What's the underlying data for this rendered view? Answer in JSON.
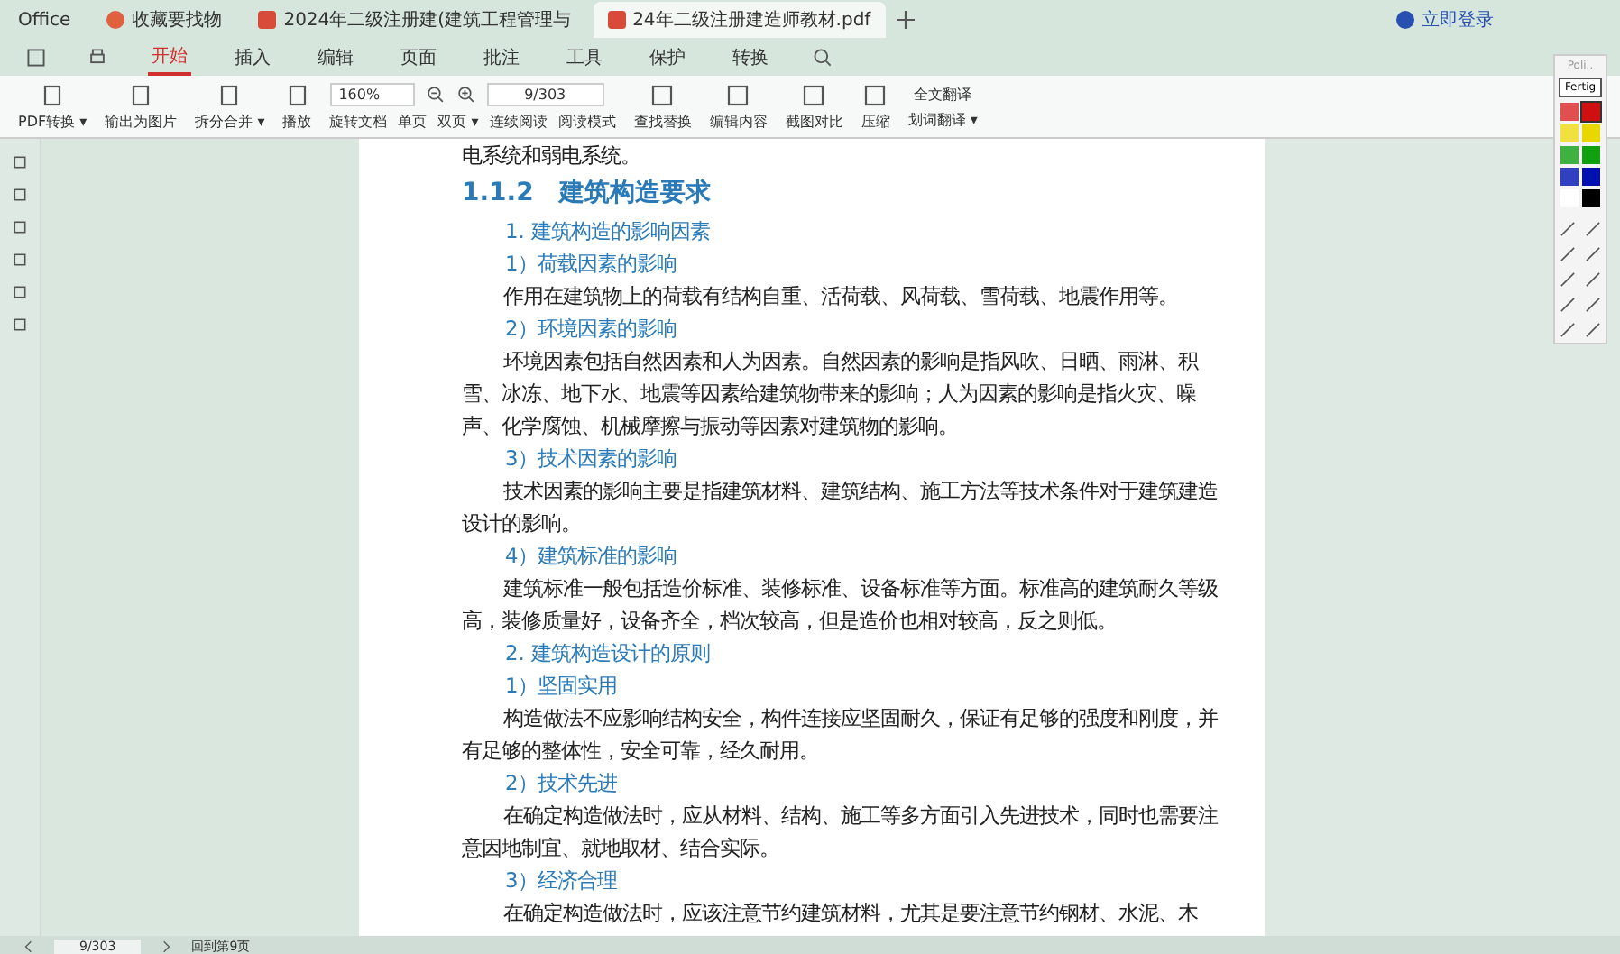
{
  "tabs": [
    {
      "label": "Office",
      "kind": "home",
      "selected": false
    },
    {
      "label": "收藏要找物",
      "kind": "doc",
      "selected": false
    },
    {
      "label": "2024年二级注册建(建筑工程管理与",
      "kind": "pdf",
      "selected": false
    },
    {
      "label": "24年二级注册建造师教材.pdf",
      "kind": "pdf",
      "selected": true
    }
  ],
  "account": {
    "label": "立即登录"
  },
  "menu": [
    {
      "label": "开始",
      "selected": true
    },
    {
      "label": "插入",
      "selected": false
    },
    {
      "label": "编辑",
      "selected": false
    },
    {
      "label": "页面",
      "selected": false
    },
    {
      "label": "批注",
      "selected": false
    },
    {
      "label": "工具",
      "selected": false
    },
    {
      "label": "保护",
      "selected": false
    },
    {
      "label": "转换",
      "selected": false
    }
  ],
  "ribbon": {
    "big": [
      {
        "label": "PDF转换 ▾"
      },
      {
        "label": "输出为图片"
      },
      {
        "label": "拆分合并 ▾"
      },
      {
        "label": "播放"
      }
    ],
    "zoom": "160%",
    "small": [
      {
        "label": "旋转文档"
      },
      {
        "label": "单页"
      },
      {
        "label": "双页 ▾"
      },
      {
        "label": "连续阅读"
      },
      {
        "label": "阅读模式"
      }
    ],
    "page": "9/303",
    "right": [
      {
        "label": "查找替换"
      },
      {
        "label": "编辑内容"
      },
      {
        "label": "截图对比"
      },
      {
        "label": "压缩"
      }
    ],
    "translate": [
      "全文翻译",
      "划词翻译 ▾"
    ]
  },
  "document": [
    {
      "kind": "paragraph",
      "text": "电系统和弱电系统。"
    },
    {
      "kind": "heading",
      "text": "1.1.2　建筑构造要求"
    },
    {
      "kind": "subheading",
      "text": "1. 建筑构造的影响因素"
    },
    {
      "kind": "subheading",
      "text": "1）荷载因素的影响"
    },
    {
      "kind": "paragraph",
      "text": "作用在建筑物上的荷载有结构自重、活荷载、风荷载、雪荷载、地震作用等。"
    },
    {
      "kind": "subheading",
      "text": "2）环境因素的影响"
    },
    {
      "kind": "paragraph",
      "text": "环境因素包括自然因素和人为因素。自然因素的影响是指风吹、日晒、雨淋、积雪、冰冻、地下水、地震等因素给建筑物带来的影响；人为因素的影响是指火灾、噪声、化学腐蚀、机械摩擦与振动等因素对建筑物的影响。"
    },
    {
      "kind": "subheading",
      "text": "3）技术因素的影响"
    },
    {
      "kind": "paragraph",
      "text": "技术因素的影响主要是指建筑材料、建筑结构、施工方法等技术条件对于建筑建造设计的影响。"
    },
    {
      "kind": "subheading",
      "text": "4）建筑标准的影响"
    },
    {
      "kind": "paragraph",
      "text": "建筑标准一般包括造价标准、装修标准、设备标准等方面。标准高的建筑耐久等级高，装修质量好，设备齐全，档次较高，但是造价也相对较高，反之则低。"
    },
    {
      "kind": "subheading",
      "text": "2. 建筑构造设计的原则"
    },
    {
      "kind": "subheading",
      "text": "1）坚固实用"
    },
    {
      "kind": "paragraph",
      "text": "构造做法不应影响结构安全，构件连接应坚固耐久，保证有足够的强度和刚度，并有足够的整体性，安全可靠，经久耐用。"
    },
    {
      "kind": "subheading",
      "text": "2）技术先进"
    },
    {
      "kind": "paragraph",
      "text": "在确定构造做法时，应从材料、结构、施工等多方面引入先进技术，同时也需要注意因地制宜、就地取材、结合实际。"
    },
    {
      "kind": "subheading",
      "text": "3）经济合理"
    },
    {
      "kind": "paragraph",
      "text": "在确定构造做法时，应该注意节约建筑材料，尤其是要注意节约钢材、水泥、木"
    }
  ],
  "pen_panel": {
    "title": "Poli..",
    "done": "Fertig",
    "swatches": [
      {
        "color": "#e05050",
        "selected": false
      },
      {
        "color": "#d01010",
        "selected": true
      },
      {
        "color": "#f0e040",
        "selected": false
      },
      {
        "color": "#e8d800",
        "selected": false
      },
      {
        "color": "#40b040",
        "selected": false
      },
      {
        "color": "#10a010",
        "selected": false
      },
      {
        "color": "#3040c0",
        "selected": false
      },
      {
        "color": "#0010b0",
        "selected": false
      },
      {
        "color": "#ffffff",
        "selected": false
      },
      {
        "color": "#000000",
        "selected": false
      }
    ]
  },
  "status_bar": {
    "page": "9/303",
    "back": "回到第9页"
  }
}
